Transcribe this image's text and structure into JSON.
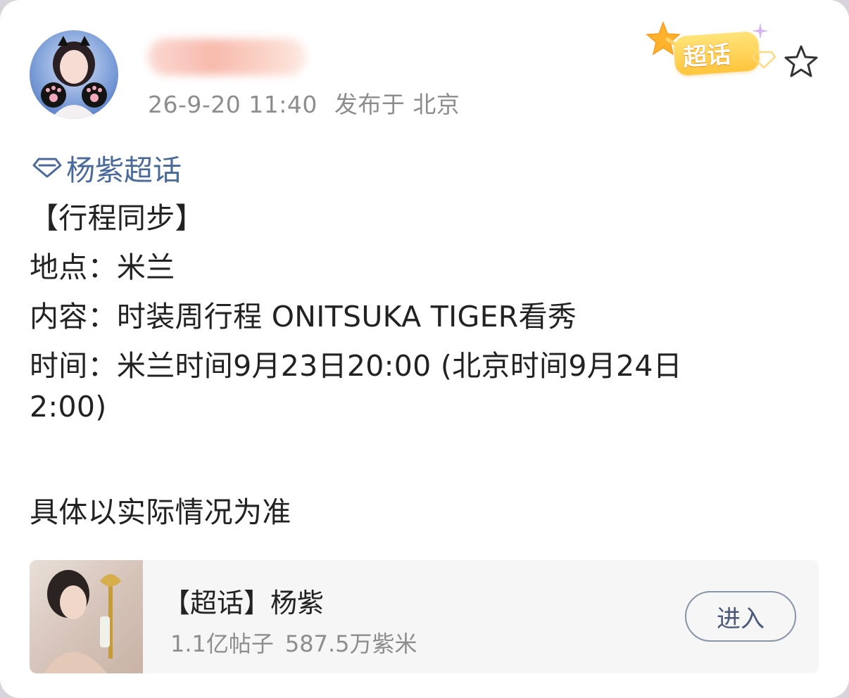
{
  "post": {
    "username": "",
    "timestamp": "26-9-20 11:40",
    "location": "发布于 北京",
    "badge_label": "超话",
    "topic_link": "杨紫超话",
    "lines": [
      "【行程同步】",
      "地点：米兰",
      "内容：时装周行程 ONITSUKA TIGER看秀",
      "时间：米兰时间9月23日20:00 (北京时间9月24日",
      "2:00)",
      "具体以实际情况为准"
    ]
  },
  "supertopic_card": {
    "title": "【超话】杨紫",
    "posts_count": "1.1亿帖子",
    "fans_count": "587.5万紫米",
    "enter_label": "进入"
  },
  "colors": {
    "link": "#4a6a9c",
    "meta": "#8d8d8d",
    "badge": "#ffc53d",
    "text": "#222222"
  },
  "icons": {
    "topic": "diamond-icon",
    "favorite": "star-outline-icon",
    "badge": "star-badge-icon"
  }
}
